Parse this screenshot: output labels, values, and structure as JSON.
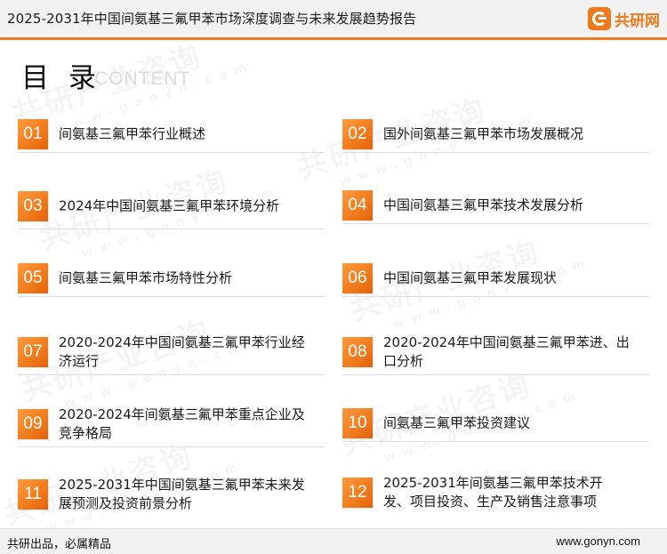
{
  "header": {
    "title": "2025-2031年中国间氨基三氟甲苯市场深度调查与未来发展趋势报告",
    "logo_text": "共研网"
  },
  "toc": {
    "heading": "目 录",
    "heading_en": "CONTENT",
    "items": [
      {
        "num": "01",
        "title": "间氨基三氟甲苯行业概述"
      },
      {
        "num": "02",
        "title": "国外间氨基三氟甲苯市场发展概况"
      },
      {
        "num": "03",
        "title": "2024年中国间氨基三氟甲苯环境分析"
      },
      {
        "num": "04",
        "title": "中国间氨基三氟甲苯技术发展分析"
      },
      {
        "num": "05",
        "title": "间氨基三氟甲苯市场特性分析"
      },
      {
        "num": "06",
        "title": "中国间氨基三氟甲苯发展现状"
      },
      {
        "num": "07",
        "title": "2020-2024年中国间氨基三氟甲苯行业经济运行"
      },
      {
        "num": "08",
        "title": "2020-2024年中国间氨基三氟甲苯进、出口分析"
      },
      {
        "num": "09",
        "title": "2020-2024年间氨基三氟甲苯重点企业及竞争格局"
      },
      {
        "num": "10",
        "title": "间氨基三氟甲苯投资建议"
      },
      {
        "num": "11",
        "title": "2025-2031年中国间氨基三氟甲苯未来发展预测及投资前景分析"
      },
      {
        "num": "12",
        "title": "2025-2031年间氨基三氟甲苯技术开发、项目投资、生产及销售注意事项"
      }
    ]
  },
  "footer": {
    "slogan": "共研出品，必属精品",
    "website": "www.gonyn.com"
  },
  "watermark": {
    "text": "共研产业咨询",
    "domain": "www.gonyn.com"
  }
}
